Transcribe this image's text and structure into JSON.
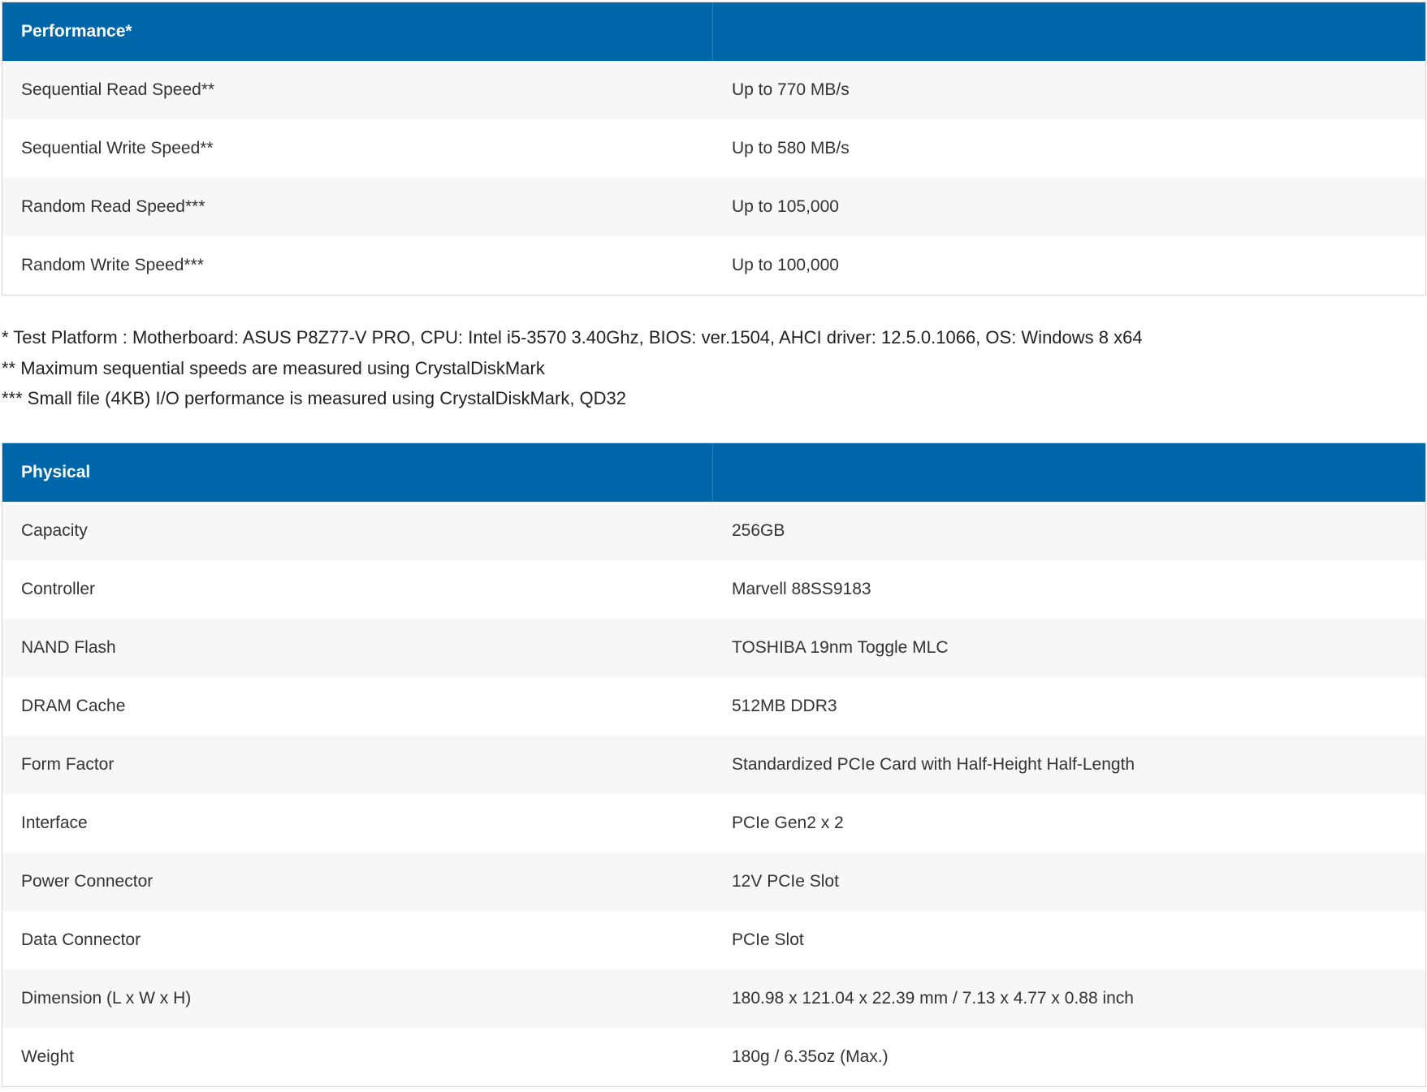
{
  "performance": {
    "header": "Performance*",
    "rows": [
      {
        "label": "Sequential Read Speed**",
        "value": "Up to 770 MB/s"
      },
      {
        "label": "Sequential Write Speed**",
        "value": "Up to 580 MB/s"
      },
      {
        "label": "Random Read Speed***",
        "value": "Up to 105,000"
      },
      {
        "label": "Random Write Speed***",
        "value": "Up to 100,000"
      }
    ]
  },
  "notes": [
    "* Test Platform : Motherboard: ASUS P8Z77-V PRO, CPU: Intel i5-3570 3.40Ghz, BIOS: ver.1504, AHCI driver: 12.5.0.1066, OS: Windows 8 x64",
    "** Maximum sequential speeds are measured using CrystalDiskMark",
    "*** Small file (4KB) I/O performance is measured using CrystalDiskMark, QD32"
  ],
  "physical": {
    "header": "Physical",
    "rows": [
      {
        "label": "Capacity",
        "value": "256GB"
      },
      {
        "label": "Controller",
        "value": "Marvell 88SS9183"
      },
      {
        "label": "NAND Flash",
        "value": "TOSHIBA 19nm Toggle MLC"
      },
      {
        "label": "DRAM Cache",
        "value": "512MB DDR3"
      },
      {
        "label": "Form Factor",
        "value": "Standardized PCIe Card with Half-Height Half-Length"
      },
      {
        "label": "Interface",
        "value": "PCIe Gen2 x 2"
      },
      {
        "label": "Power Connector",
        "value": "12V PCIe Slot"
      },
      {
        "label": "Data Connector",
        "value": "PCIe Slot"
      },
      {
        "label": "Dimension (L x W x H)",
        "value": "180.98 x 121.04 x 22.39 mm / 7.13 x 4.77 x 0.88 inch"
      },
      {
        "label": "Weight",
        "value": "180g / 6.35oz (Max.)"
      }
    ]
  },
  "colors": {
    "header_bg": "#0066aa",
    "row_alt_bg": "#f7f7f7"
  }
}
